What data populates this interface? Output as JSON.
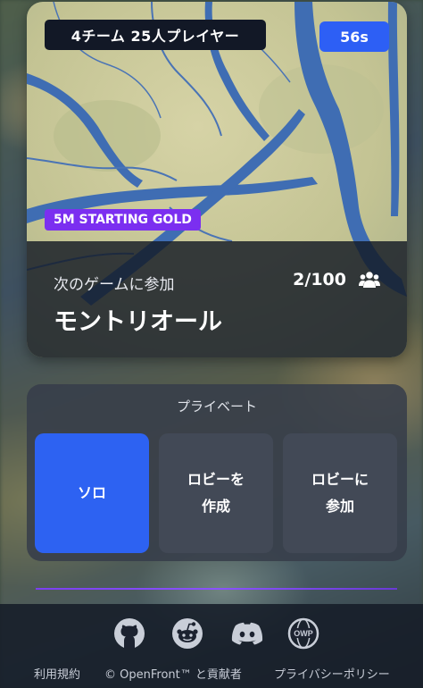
{
  "game_card": {
    "mode_label": "4チーム 25人プレイヤー",
    "timer": "56s",
    "gold_badge": "5M STARTING GOLD",
    "join_label": "次のゲームに参加",
    "map_name": "モントリオール",
    "player_count": "2/100"
  },
  "private": {
    "title": "プライベート",
    "solo_label": "ソロ",
    "create_lobby_label": "ロビーを\n作成",
    "join_lobby_label": "ロビーに\n参加"
  },
  "footer": {
    "social_icons": [
      "github-icon",
      "reddit-icon",
      "discord-icon",
      "owp-icon"
    ],
    "terms": "利用規約",
    "copyright": "© OpenFront™ と貢献者",
    "privacy": "プライバシーポリシー"
  },
  "colors": {
    "accent_blue": "#2d5ff5",
    "gold_purple": "#7b2ff0",
    "panel": "#373e4a",
    "button_dark": "#424956",
    "river": "#3f6db3",
    "land": "#c9c79b"
  }
}
